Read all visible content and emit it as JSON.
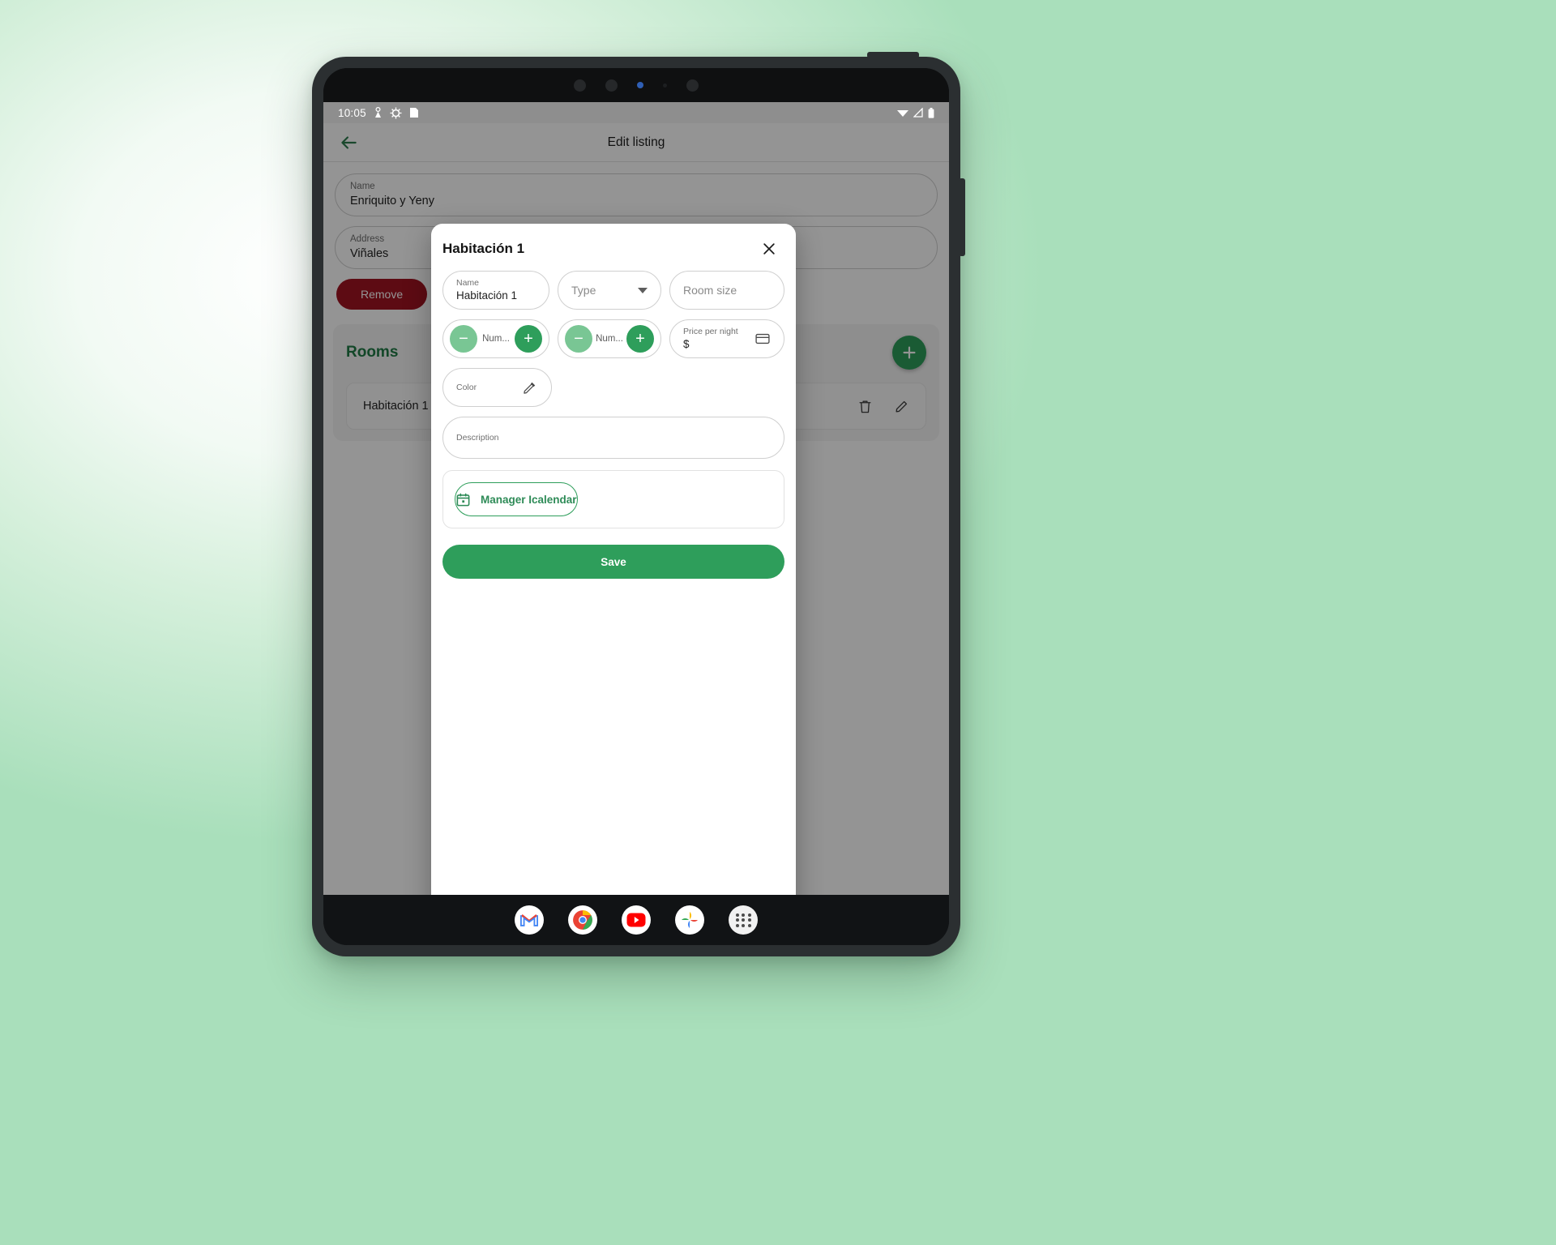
{
  "status_bar": {
    "time": "10:05",
    "icons": [
      "location-icon",
      "gear-icon",
      "sd-card-icon"
    ],
    "right_icons": [
      "wifi-icon",
      "signal-icon",
      "battery-icon"
    ]
  },
  "app": {
    "title": "Edit listing",
    "back_icon": "back-arrow-icon",
    "fields": [
      {
        "label": "Name",
        "value": "Enriquito y Yeny"
      },
      {
        "label": "Address",
        "value": "Viñales"
      }
    ],
    "buttons": {
      "remove": "Remove",
      "secondary": ""
    },
    "rooms_section": {
      "title": "Rooms",
      "add_icon": "plus-icon",
      "rows": [
        {
          "name": "Habitación 1",
          "delete_icon": "trash-icon",
          "edit_icon": "pencil-icon"
        }
      ]
    }
  },
  "dialog": {
    "title": "Habitación 1",
    "close_icon": "close-icon",
    "name_field": {
      "label": "Name",
      "value": "Habitación 1"
    },
    "type_field": {
      "placeholder": "Type",
      "caret_icon": "chevron-down-icon"
    },
    "room_size_field": {
      "placeholder": "Room size"
    },
    "stepper_1": {
      "label": "Num...",
      "minus_icon": "minus-icon",
      "plus_icon": "plus-icon"
    },
    "stepper_2": {
      "label": "Num...",
      "minus_icon": "minus-icon",
      "plus_icon": "plus-icon"
    },
    "price_field": {
      "label": "Price per night",
      "value": "$",
      "icon": "credit-card-icon"
    },
    "color_field": {
      "label": "Color",
      "icon": "eyedropper-icon"
    },
    "description_field": {
      "label": "Description"
    },
    "icalendar_button": {
      "label": "Manager Icalendar",
      "icon": "calendar-icon"
    },
    "save_button": "Save"
  },
  "dock": {
    "items": [
      "gmail-icon",
      "chrome-icon",
      "youtube-icon",
      "photos-icon",
      "app-drawer-icon"
    ]
  },
  "colors": {
    "primary_green": "#2e9e5b",
    "dark_green": "#1f7a45",
    "light_green": "#79c694",
    "remove_red": "#a01321"
  }
}
